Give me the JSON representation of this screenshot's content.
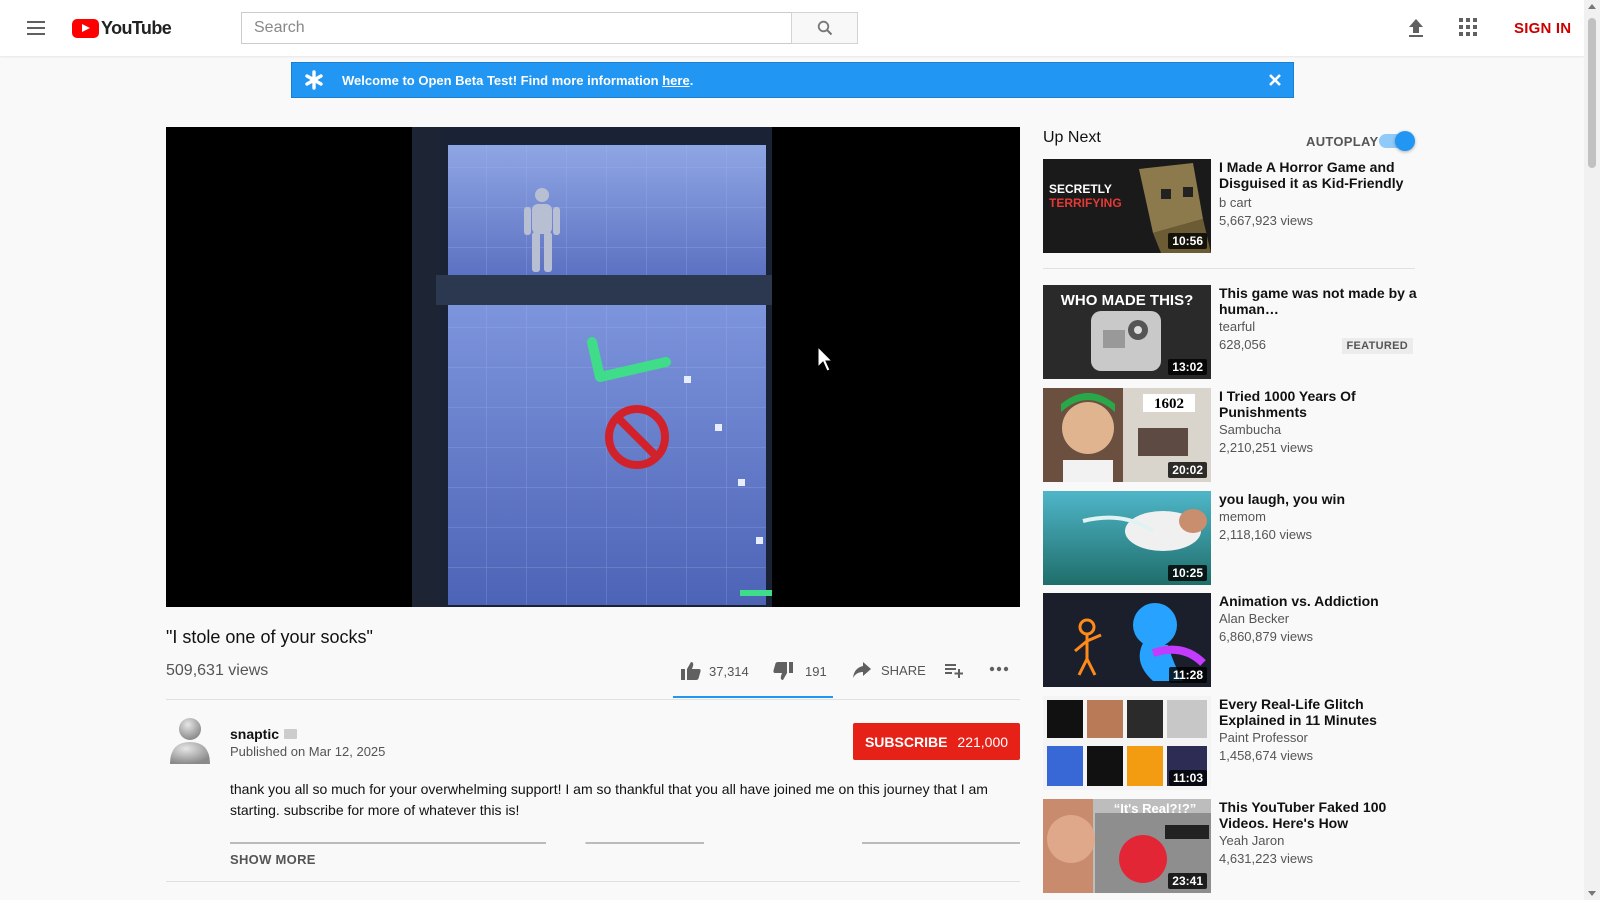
{
  "header": {
    "logo_text": "YouTube",
    "search_placeholder": "Search",
    "sign_in": "SIGN IN"
  },
  "banner": {
    "text": "Welcome to Open Beta Test! Find more information ",
    "link": "here",
    "suffix": "."
  },
  "video": {
    "title": "\"I stole one of your socks\"",
    "views": "509,631 views",
    "likes": "37,314",
    "dislikes": "191",
    "share": "SHARE"
  },
  "owner": {
    "channel": "snaptic",
    "published": "Published on Mar 12, 2025",
    "subscribe": "SUBSCRIBE",
    "subscribers": "221,000",
    "description": "thank you all so much for your overwhelming support! I am so thankful that you all have joined me on this journey that I am starting. subscribe for more of whatever this is!",
    "show_more": "SHOW MORE"
  },
  "sidebar": {
    "up_next": "Up Next",
    "autoplay": "AUTOPLAY",
    "autoplay_on": true,
    "items": [
      {
        "title": "I Made A Horror Game and Disguised it as Kid-Friendly",
        "channel": "b cart",
        "views": "5,667,923 views",
        "duration": "10:56",
        "thumb_text": "SECRETLY",
        "thumb_text2": "TERRIFYING"
      },
      {
        "title": "This game was not made by a human…",
        "channel": "tearful",
        "views": "628,056",
        "duration": "13:02",
        "badge": "FEATURED",
        "thumb_text": "WHO MADE THIS?"
      },
      {
        "title": "I Tried 1000 Years Of Punishments",
        "channel": "Sambucha",
        "views": "2,210,251 views",
        "duration": "20:02",
        "thumb_text": "1602"
      },
      {
        "title": "you laugh, you win",
        "channel": "memom",
        "views": "2,118,160 views",
        "duration": "10:25"
      },
      {
        "title": "Animation vs. Addiction",
        "channel": "Alan Becker",
        "views": "6,860,879 views",
        "duration": "11:28"
      },
      {
        "title": "Every Real-Life Glitch Explained in 11 Minutes",
        "channel": "Paint Professor",
        "views": "1,458,674 views",
        "duration": "11:03"
      },
      {
        "title": "This YouTuber Faked 100 Videos. Here's How",
        "channel": "Yeah Jaron",
        "views": "4,631,223 views",
        "duration": "23:41",
        "thumb_text": "“It's Real?!?”"
      }
    ]
  },
  "colors": {
    "brand_red": "#ff0000",
    "subscribe_red": "#e62117",
    "banner_blue": "#2196f3",
    "signin_red": "#cc0000"
  }
}
